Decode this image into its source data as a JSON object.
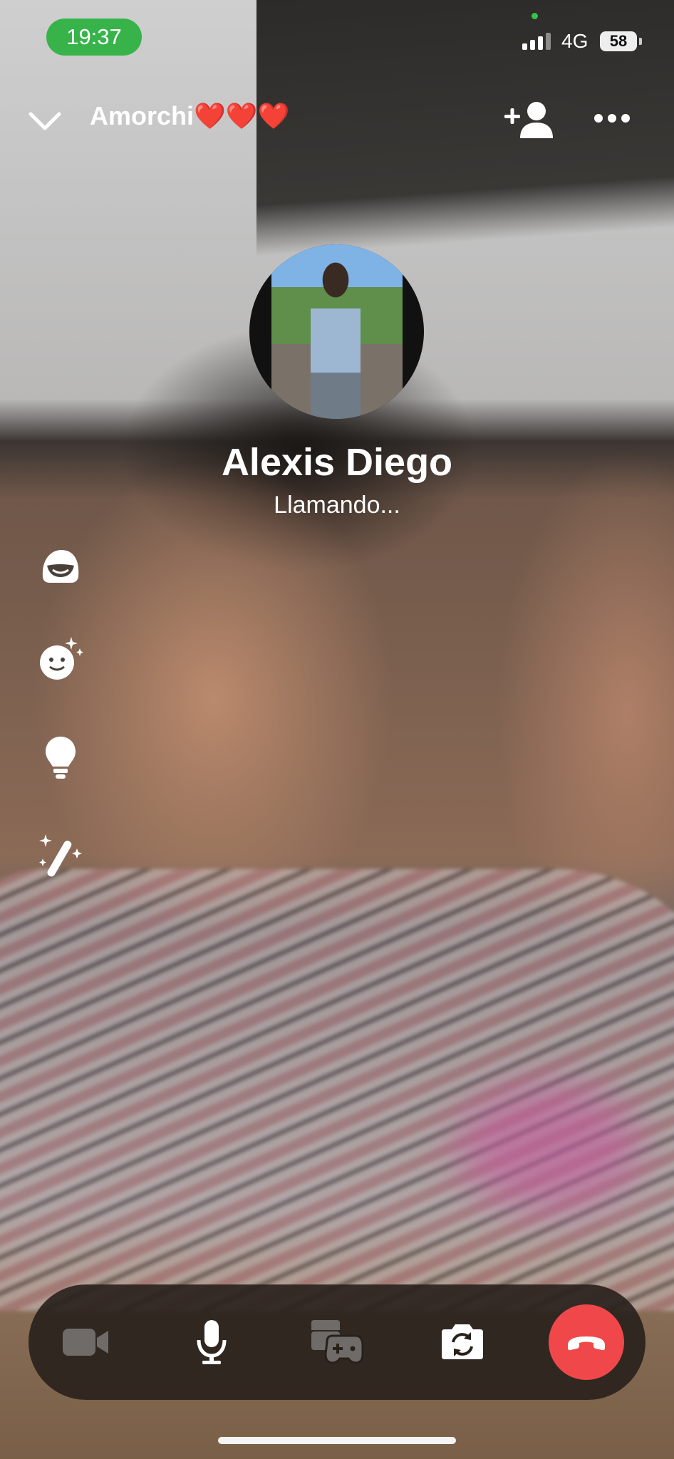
{
  "status_bar": {
    "time": "19:37",
    "network": "4G",
    "battery": "58",
    "time_pill_color": "#37b34a"
  },
  "header": {
    "title": "Amorchi❤️❤️❤️",
    "back_icon": "chevron-down-icon",
    "add_icon": "add-person-icon",
    "more_icon": "more-horizontal-icon"
  },
  "caller": {
    "name": "Alexis Diego",
    "status": "Llamando..."
  },
  "side_tools": [
    {
      "icon": "avatar-face-icon"
    },
    {
      "icon": "sparkle-emoji-icon"
    },
    {
      "icon": "lightbulb-icon"
    },
    {
      "icon": "magic-wand-icon"
    }
  ],
  "controls": {
    "video_icon": "video-camera-icon",
    "mic_icon": "microphone-icon",
    "games_icon": "games-icon",
    "flip_icon": "flip-camera-icon",
    "end_icon": "end-call-icon",
    "end_color": "#f0484a"
  }
}
